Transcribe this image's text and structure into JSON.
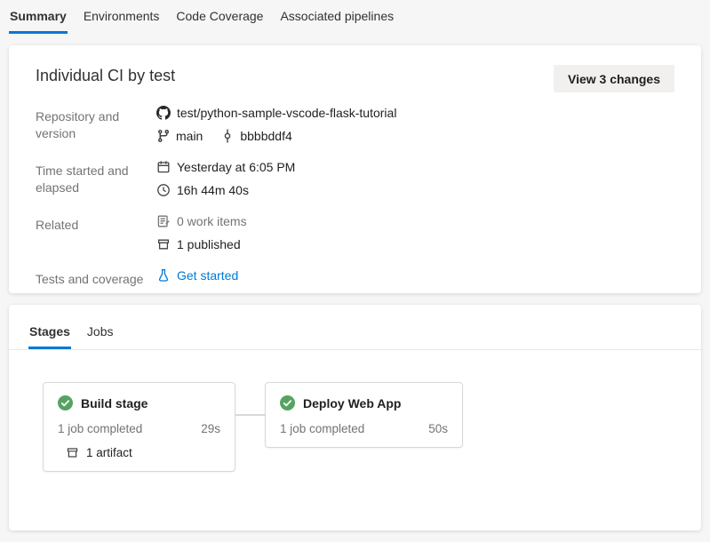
{
  "colors": {
    "accent": "#0078d4",
    "success_green": "#55a362",
    "card_bg": "#ffffff",
    "page_bg": "#f6f6f6"
  },
  "top_tabs": [
    {
      "label": "Summary",
      "active": true
    },
    {
      "label": "Environments",
      "active": false
    },
    {
      "label": "Code Coverage",
      "active": false
    },
    {
      "label": "Associated pipelines",
      "active": false
    }
  ],
  "summary_card": {
    "title": "Individual CI by test",
    "view_changes_label": "View 3 changes",
    "rows": {
      "repository": {
        "label": "Repository and version",
        "repo": "test/python-sample-vscode-flask-tutorial",
        "branch": "main",
        "commit": "bbbbddf4"
      },
      "time": {
        "label": "Time started and elapsed",
        "started": "Yesterday at 6:05 PM",
        "elapsed": "16h 44m 40s"
      },
      "related": {
        "label": "Related",
        "work_items": "0 work items",
        "published": "1 published"
      },
      "tests": {
        "label": "Tests and coverage",
        "get_started": "Get started"
      }
    }
  },
  "stages_card": {
    "tabs": [
      {
        "label": "Stages",
        "active": true
      },
      {
        "label": "Jobs",
        "active": false
      }
    ],
    "stages": [
      {
        "name": "Build stage",
        "status": "1 job completed",
        "duration": "29s",
        "artifact": "1 artifact"
      },
      {
        "name": "Deploy Web App",
        "status": "1 job completed",
        "duration": "50s"
      }
    ]
  }
}
